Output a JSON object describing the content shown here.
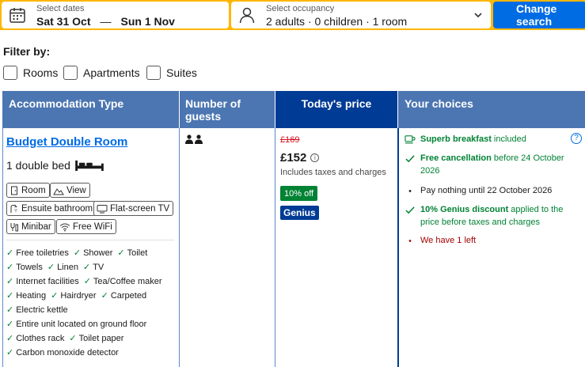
{
  "search": {
    "dates_label": "Select dates",
    "check_in": "Sat 31 Oct",
    "dash": "—",
    "check_out": "Sun 1 Nov",
    "occupancy_label": "Select occupancy",
    "occupancy_value": "2 adults · 0 children · 1 room",
    "change_button": "Change search"
  },
  "filters": {
    "label": "Filter by:",
    "options": [
      "Rooms",
      "Apartments",
      "Suites"
    ]
  },
  "table": {
    "headers": [
      "Accommodation Type",
      "Number of guests",
      "Today's price",
      "Your choices"
    ]
  },
  "room": {
    "name": "Budget Double Room",
    "bed": "1 double bed",
    "chips": [
      "Room",
      "View",
      "Ensuite bathroom",
      "Flat-screen TV",
      "Minibar",
      "Free WiFi"
    ],
    "features": [
      [
        "Free toiletries",
        "Shower",
        "Toilet"
      ],
      [
        "Towels",
        "Linen",
        "TV"
      ],
      [
        "Internet facilities",
        "Tea/Coffee maker"
      ],
      [
        "Heating",
        "Hairdryer",
        "Carpeted"
      ],
      [
        "Electric kettle"
      ],
      [
        "Entire unit located on ground floor"
      ],
      [
        "Clothes rack",
        "Toilet paper"
      ],
      [
        "Carbon monoxide detector"
      ]
    ]
  },
  "price": {
    "old": "£169",
    "now": "£152",
    "info": "i",
    "note": "Includes taxes and charges",
    "discount": "10% off",
    "genius": "Genius"
  },
  "choices": {
    "breakfast_bold": "Superb breakfast",
    "breakfast_rest": " included",
    "cancel_bold": "Free cancellation",
    "cancel_rest": " before 24 October 2026",
    "pay": "Pay nothing until 22 October 2026",
    "genius_bold": "10% Genius discount",
    "genius_rest": " applied to the price before taxes and charges",
    "left": "We have 1 left",
    "help": "?"
  },
  "colors": {
    "searchbar": "#ffb700",
    "primary": "#006ce4",
    "header": "#4c76b2",
    "header_dark": "#003b95",
    "green": "#008234",
    "red": "#d4111e"
  },
  "icons": {
    "dates": "calendar-icon",
    "occupancy": "person-icon",
    "chevron": "chevron-down-icon",
    "bed": "double-bed-icon",
    "guests": "two-persons-icon",
    "breakfast": "coffee-cup-icon",
    "help": "help-icon"
  }
}
